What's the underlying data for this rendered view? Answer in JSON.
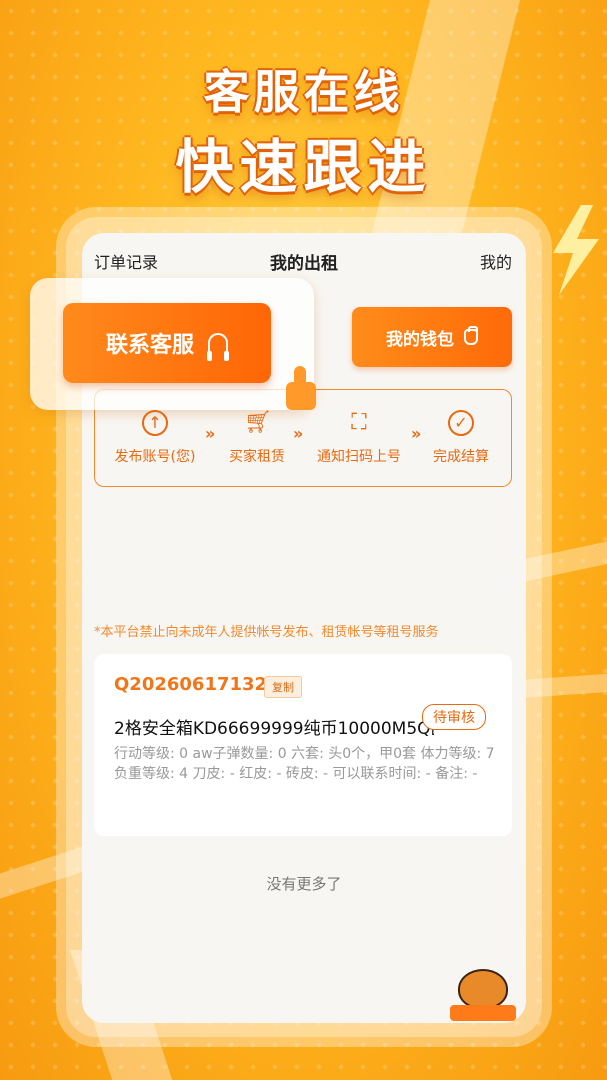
{
  "headline": {
    "line1": "客服在线",
    "line2": "快速跟进"
  },
  "nav": {
    "left": "订单记录",
    "title": "我的出租",
    "right": "我的"
  },
  "contact_button": {
    "label": "联系客服",
    "icon": "headset-icon"
  },
  "wallet_button": {
    "label": "我的钱包",
    "icon": "wallet-icon"
  },
  "steps": [
    {
      "label": "发布账号(您)",
      "icon": "arrow-up-circle-icon"
    },
    {
      "label": "买家租赁",
      "icon": "cart-icon"
    },
    {
      "label": "通知扫码上号",
      "icon": "scan-icon"
    },
    {
      "label": "完成结算",
      "icon": "check-circle-icon"
    }
  ],
  "notice": "*本平台禁止向未成年人提供帐号发布、租赁帐号等租号服务",
  "order": {
    "id": "Q20260617132",
    "copy_label": "复制",
    "title": "2格安全箱KD66699999纯币10000M5Q区",
    "status": "待审核",
    "description": "行动等级: 0 aw子弹数量: 0 六套: 头0个，甲0套 体力等级: 7 负重等级: 4 刀皮: - 红皮: - 砖皮: - 可以联系时间: - 备注: -"
  },
  "no_more": "没有更多了",
  "colors": {
    "accent": "#ff6a08",
    "accent_text": "#e86a10",
    "background": "#ffb820"
  }
}
